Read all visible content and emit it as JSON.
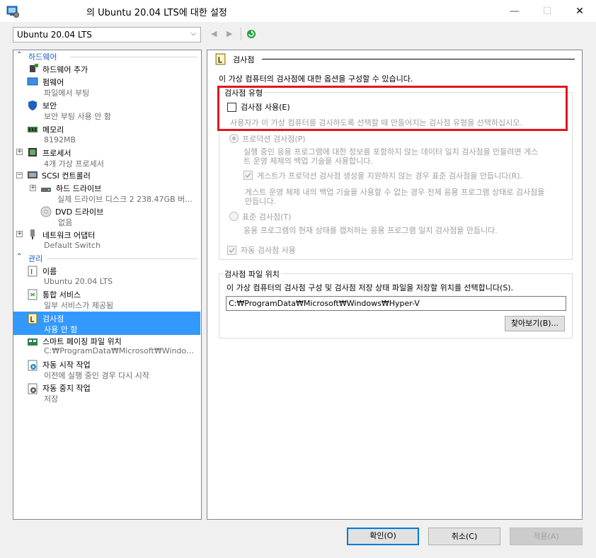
{
  "window": {
    "title": "의 Ubuntu 20.04 LTS에 대한 설정",
    "minimize": "—",
    "maximize": "☐",
    "close": "✕"
  },
  "toolbar": {
    "vm_name": "Ubuntu 20.04 LTS"
  },
  "tree": {
    "hardware_header": "하드웨어",
    "manage_header": "관리",
    "hardware": [
      {
        "label": "하드웨어 추가",
        "sub": ""
      },
      {
        "label": "펌웨어",
        "sub": "파일에서 부팅"
      },
      {
        "label": "보안",
        "sub": "보안 부팅 사용 안 함"
      },
      {
        "label": "메모리",
        "sub": "8192MB"
      },
      {
        "label": "프로세서",
        "sub": "4개 가상 프로세서"
      },
      {
        "label": "SCSI 컨트롤러",
        "sub": ""
      },
      {
        "label": "하드 드라이브",
        "sub": "실제 드라이브 디스크 2 238.47GB 버..."
      },
      {
        "label": "DVD 드라이브",
        "sub": "없음"
      },
      {
        "label": "네트워크 어댑터",
        "sub": "Default Switch"
      }
    ],
    "manage": [
      {
        "label": "이름",
        "sub": "Ubuntu 20.04 LTS"
      },
      {
        "label": "통합 서비스",
        "sub": "일부 서비스가 제공됨"
      },
      {
        "label": "검사점",
        "sub": "사용 안 함"
      },
      {
        "label": "스마트 페이징 파일 위치",
        "sub": "C:₩ProgramData₩Microsoft₩Windows₩..."
      },
      {
        "label": "자동 시작 작업",
        "sub": "이전에 실행 중인 경우 다시 시작"
      },
      {
        "label": "자동 중지 작업",
        "sub": "저장"
      }
    ]
  },
  "checkpoint": {
    "heading": "검사점",
    "description": "이 가상 컴퓨터의 검사점에 대한 옵션을 구성할 수 있습니다.",
    "type_group": "검사점 유형",
    "enable_label": "검사점 사용(E)",
    "enable_checked": false,
    "enable_hint": "사용자가 이 가상 컴퓨터를 검사하도록 선택할 때 만들어지는 검사점 유형을 선택하십시오.",
    "production_label": "프로덕션 검사점(P)",
    "production_desc_1": "실행 중인 응용 프로그램에 대한 정보를 포함하지 않는 데이터 일치 검사점을 만들려면 게스",
    "production_desc_2": "트 운영 체제의 백업 기술을 사용합니다.",
    "fallback_label": "게스트가 프로덕션 검사점 생성을 지원하지 않는 경우 표준 검사점을 만듭니다(R).",
    "fallback_desc_1": "게스트 운영 체제 내의 백업 기술을 사용할 수 없는 경우 전체 응용 프로그램 상태로 검사점을",
    "fallback_desc_2": "만듭니다.",
    "standard_label": "표준 검사점(T)",
    "standard_desc": "응용 프로그램의 현재 상태를 캡처하는 응용 프로그램 일치 검사점을 만듭니다.",
    "auto_label": "자동 검사점 사용",
    "location_group": "검사점 파일 위치",
    "location_desc": "이 가상 컴퓨터의 검사점 구성 및 검사점 저장 상태 파일을 저장할 위치를 선택합니다(S).",
    "location_path": "C:₩ProgramData₩Microsoft₩Windows₩Hyper-V",
    "browse": "찾아보기(B)..."
  },
  "buttons": {
    "ok": "확인(O)",
    "cancel": "취소(C)",
    "apply": "적용(A)"
  },
  "colors": {
    "accent": "#3399ff",
    "section_header": "#1b5fc1",
    "highlight_box": "#e0161f"
  }
}
